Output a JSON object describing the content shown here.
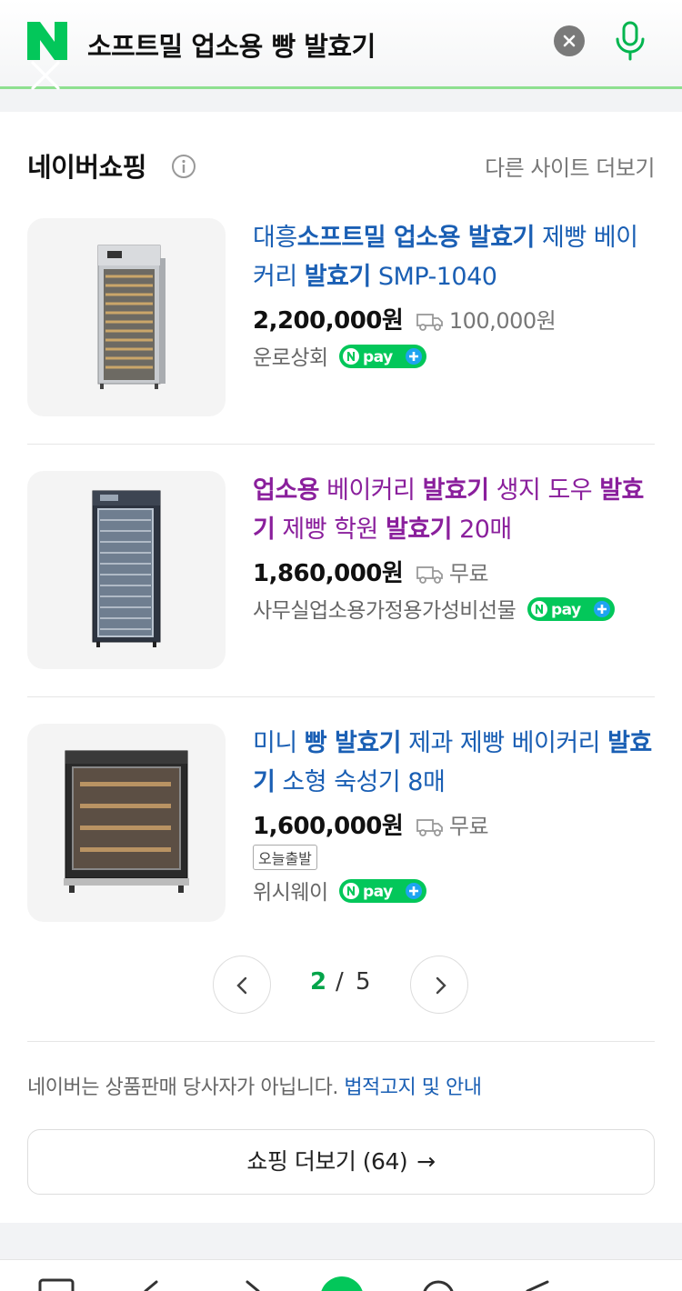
{
  "search": {
    "query": "소프트밀 업소용 빵 발효기"
  },
  "section": {
    "title": "네이버쇼핑",
    "other_sites": "다른 사이트 더보기"
  },
  "products": [
    {
      "title_parts": [
        {
          "text": "대흥",
          "bold": false
        },
        {
          "text": "소프트밀 업소용 발효기",
          "bold": true
        },
        {
          "text": " 제빵 베이커리 ",
          "bold": false
        },
        {
          "text": "발효기",
          "bold": true
        },
        {
          "text": " SMP-1040",
          "bold": false
        }
      ],
      "title_color": "#1a5fb4",
      "price": "2,200,000원",
      "shipping": "100,000원",
      "seller": "운로상회",
      "pay_badge": "pay"
    },
    {
      "title_parts": [
        {
          "text": "업소용",
          "bold": true
        },
        {
          "text": " 베이커리 ",
          "bold": false
        },
        {
          "text": "발효기",
          "bold": true
        },
        {
          "text": " 생지 도우 ",
          "bold": false
        },
        {
          "text": "발효기",
          "bold": true
        },
        {
          "text": " 제빵 학원 ",
          "bold": false
        },
        {
          "text": "발효기",
          "bold": true
        },
        {
          "text": " 20매",
          "bold": false
        }
      ],
      "title_color": "#8a1f9c",
      "price": "1,860,000원",
      "shipping": "무료",
      "seller": "사무실업소용가정용가성비선물",
      "pay_badge": "pay"
    },
    {
      "title_parts": [
        {
          "text": "미니 ",
          "bold": false
        },
        {
          "text": "빵 발효기",
          "bold": true
        },
        {
          "text": " 제과 제빵 베이커리 ",
          "bold": false
        },
        {
          "text": "발효기",
          "bold": true
        },
        {
          "text": " 소형 숙성기 8매",
          "bold": false
        }
      ],
      "title_color": "#1a5fb4",
      "price": "1,600,000원",
      "shipping": "무료",
      "badge": "오늘출발",
      "seller": "위시웨이",
      "pay_badge": "pay"
    }
  ],
  "pagination": {
    "current": "2",
    "separator": "/",
    "total": "5"
  },
  "notice": {
    "text": "네이버는 상품판매 당사자가 아닙니다. ",
    "link": "법적고지 및 안내"
  },
  "more_button": {
    "label": "쇼핑 더보기 (64)",
    "arrow": "→"
  },
  "colors": {
    "naver_green": "#03c75a",
    "link_blue": "#1a5fb4",
    "visited_purple": "#8a1f9c",
    "npay_green": "#03c75a"
  },
  "icons": [
    "naver-logo",
    "clear-icon",
    "mic-icon",
    "close-icon",
    "info-icon",
    "truck-icon",
    "npay-plus-icon",
    "chevron-left-icon",
    "chevron-right-icon"
  ]
}
